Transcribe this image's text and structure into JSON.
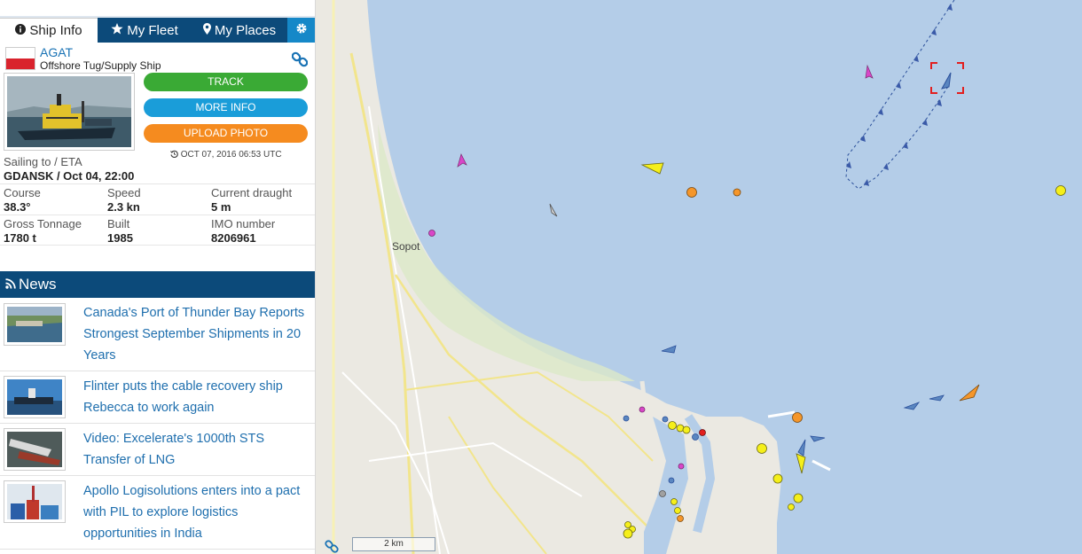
{
  "tabs": {
    "ship_info": "Ship Info",
    "my_fleet": "My Fleet",
    "my_places": "My Places"
  },
  "ship": {
    "name": "AGAT",
    "type": "Offshore Tug/Supply Ship",
    "buttons": {
      "track": "TRACK",
      "more_info": "MORE INFO",
      "upload_photo": "UPLOAD PHOTO"
    },
    "timestamp": "OCT 07, 2016 06:53 UTC",
    "sailing_label": "Sailing to / ETA",
    "sailing_value": "GDANSK / Oct 04, 22:00",
    "course_label": "Course",
    "course_value": "38.3°",
    "speed_label": "Speed",
    "speed_value": "2.3 kn",
    "draught_label": "Current draught",
    "draught_value": "5 m",
    "gross_tonnage_label": "Gross Tonnage",
    "gross_tonnage_value": "1780 t",
    "built_label": "Built",
    "built_value": "1985",
    "imo_label": "IMO number",
    "imo_value": "8206961"
  },
  "news": {
    "header": "News",
    "items": [
      {
        "title": "Canada's Port of Thunder Bay Reports Strongest September Shipments in 20 Years"
      },
      {
        "title": "Flinter puts the cable recovery ship Rebecca to work again"
      },
      {
        "title": "Video: Excelerate's 1000th STS Transfer of LNG"
      },
      {
        "title": "Apollo Logisolutions enters into a pact with PIL to explore logistics opportunities in India"
      }
    ]
  },
  "map": {
    "place_label": "Sopot",
    "scale_label": "2 km"
  },
  "colors": {
    "nav_dark": "#0c4a7a",
    "link_blue": "#1a73b5",
    "track_green": "#3aaa35",
    "more_info_blue": "#1a9dd9",
    "upload_orange": "#f58b1f",
    "sea": "#b4cde8",
    "land": "#ebe9e2"
  },
  "icons": [
    "info-icon",
    "star-icon",
    "map-marker-icon",
    "gear-icon",
    "link-icon",
    "history-icon",
    "rss-icon"
  ]
}
